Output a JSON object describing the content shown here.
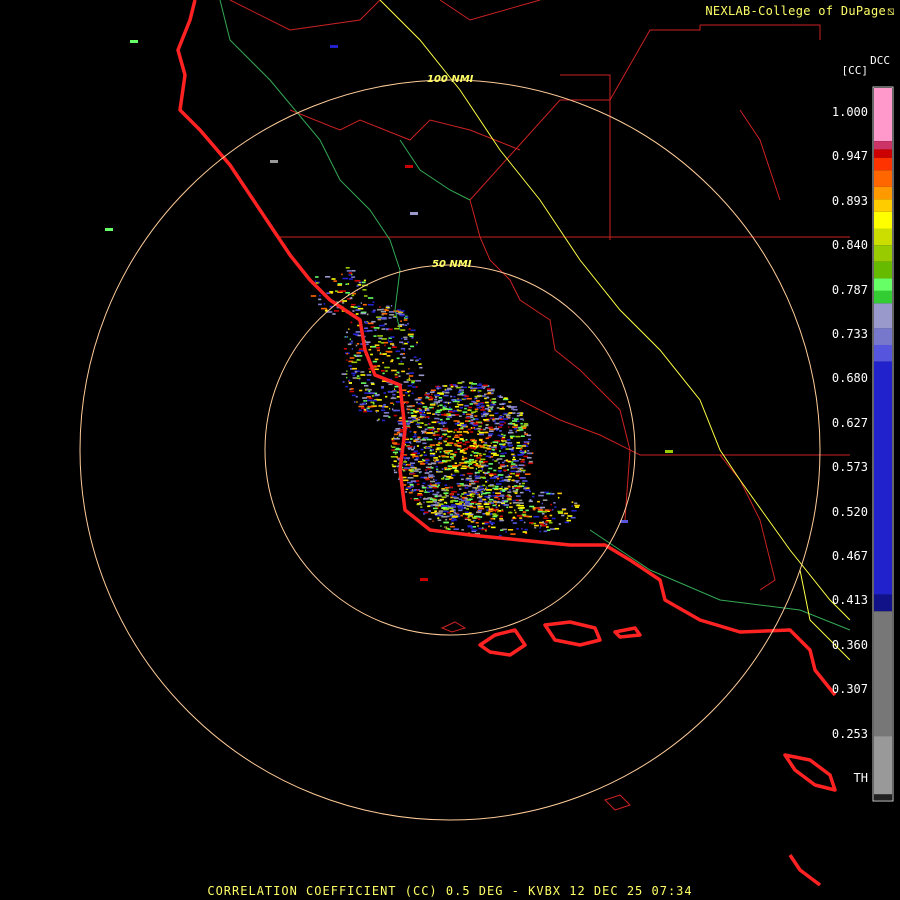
{
  "header": {
    "credit": "NEXLAB-College of DuPage",
    "product_name": "DCC",
    "product_code": "[CC]"
  },
  "footer": {
    "caption": "CORRELATION COEFFICIENT (CC) 0.5 DEG - KVBX 12 DEC 25 07:34"
  },
  "range_rings": [
    {
      "label": "100 NMI",
      "range_nmi": 100
    },
    {
      "label": "50 NMI",
      "range_nmi": 50
    }
  ],
  "color_scale": {
    "labels": [
      "1.000",
      "0.947",
      "0.893",
      "0.840",
      "0.787",
      "0.733",
      "0.680",
      "0.627",
      "0.573",
      "0.520",
      "0.467",
      "0.413",
      "0.360",
      "0.307",
      "0.253",
      "TH"
    ],
    "bands": [
      {
        "value": 1.0,
        "color": "#ff99cc"
      },
      {
        "value": 0.965,
        "color": "#cc3366"
      },
      {
        "value": 0.955,
        "color": "#cc0000"
      },
      {
        "value": 0.945,
        "color": "#ff3300"
      },
      {
        "value": 0.93,
        "color": "#ff6600"
      },
      {
        "value": 0.91,
        "color": "#ff9900"
      },
      {
        "value": 0.895,
        "color": "#ffcc00"
      },
      {
        "value": 0.88,
        "color": "#ffff00"
      },
      {
        "value": 0.86,
        "color": "#ccdd00"
      },
      {
        "value": 0.84,
        "color": "#99cc00"
      },
      {
        "value": 0.82,
        "color": "#66bb00"
      },
      {
        "value": 0.8,
        "color": "#66ff66"
      },
      {
        "value": 0.785,
        "color": "#33cc33"
      },
      {
        "value": 0.77,
        "color": "#9999cc"
      },
      {
        "value": 0.74,
        "color": "#7777cc"
      },
      {
        "value": 0.72,
        "color": "#5555dd"
      },
      {
        "value": 0.7,
        "color": "#2222cc"
      },
      {
        "value": 0.42,
        "color": "#111188"
      },
      {
        "value": 0.4,
        "color": "#777777"
      },
      {
        "value": 0.25,
        "color": "#999999"
      },
      {
        "value": 0.18,
        "color": "#222222"
      }
    ]
  },
  "colors": {
    "coastline": "#ff2222",
    "county_lines": "#cc2222",
    "highways": "#ffff44",
    "rivers": "#33aa55",
    "range_ring": "#ffcc99",
    "text_accent": "#ffff66"
  }
}
